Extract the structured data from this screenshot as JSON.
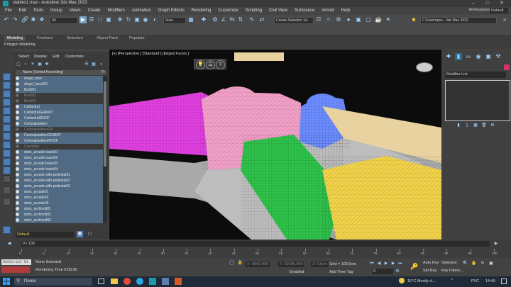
{
  "window": {
    "title": "stables1.max - Autodesk 3ds Max 2023",
    "minimize_icon": "minimize-icon",
    "maximize_icon": "maximize-icon",
    "close_icon": "close-icon"
  },
  "menu": {
    "items": [
      "File",
      "Edit",
      "Tools",
      "Group",
      "Views",
      "Create",
      "Modifiers",
      "Animation",
      "Graph Editors",
      "Rendering",
      "Customize",
      "Scripting",
      "Civil View",
      "Substance",
      "Arnold",
      "Help"
    ],
    "workspaces_label": "Workspaces:",
    "workspaces_value": "Default"
  },
  "toolbar": {
    "filter_value": "All",
    "view_value": "View",
    "selection_set_placeholder": "Create Selection Se",
    "path_value": "C:\\Users\\pce...3ds Max 2023"
  },
  "ribbon": {
    "tabs": [
      "Modeling",
      "Freeform",
      "Selection",
      "Object Paint",
      "Populate"
    ],
    "active_tab": "Modeling",
    "sub_label": "Polygon Modeling"
  },
  "explorer": {
    "tabs": [
      "Select",
      "Display",
      "Edit",
      "Customize"
    ],
    "column_header": "Name (Sorted Ascending)",
    "column_header_right": "Fr",
    "rows": [
      {
        "name": "Angel_face",
        "state": "sel"
      },
      {
        "name": "Angel_face001",
        "state": "sel"
      },
      {
        "name": "Box001",
        "state": "sel"
      },
      {
        "name": "Box002",
        "state": "dim"
      },
      {
        "name": "Box003",
        "state": "dim"
      },
      {
        "name": "Cathedral",
        "state": "sel"
      },
      {
        "name": "CathedralGRANIT",
        "state": "sel"
      },
      {
        "name": "CathedralROOF",
        "state": "sel"
      },
      {
        "name": "Centralpavilion",
        "state": "sel"
      },
      {
        "name": "Centralpavilion001",
        "state": "dim"
      },
      {
        "name": "CentralpavilionGRANIT",
        "state": "sel"
      },
      {
        "name": "CentralpavilionROOF",
        "state": "sel"
      },
      {
        "name": "Cupolaire",
        "state": "dim"
      },
      {
        "name": "doric_arcade basis01",
        "state": "sel"
      },
      {
        "name": "doric_arcade basis02",
        "state": "sel"
      },
      {
        "name": "doric_arcade basis03",
        "state": "sel"
      },
      {
        "name": "doric_arcade basis04",
        "state": "sel"
      },
      {
        "name": "doric_arcade with pedestal01",
        "state": "sel"
      },
      {
        "name": "doric_arcade with pedestal02",
        "state": "sel"
      },
      {
        "name": "doric_arcade with pedestal03",
        "state": "sel"
      },
      {
        "name": "doric_arcade01",
        "state": "sel"
      },
      {
        "name": "doric_arcade02",
        "state": "sel"
      },
      {
        "name": "doric_arcade03",
        "state": "sel"
      },
      {
        "name": "doric_archivolt01",
        "state": "sel"
      },
      {
        "name": "doric_archivolt02",
        "state": "sel"
      },
      {
        "name": "doric_archivolt03",
        "state": "sel"
      }
    ],
    "layer_value": "Default"
  },
  "viewport": {
    "label": "[+] [Perspective ] [Standard ] [Edged Faces ]",
    "colors": {
      "magenta": "#e040e0",
      "green": "#2ec24a",
      "pink": "#f2a0c8",
      "blue": "#6b8cff",
      "yellow": "#f2d24a",
      "cream": "#e8d2a0",
      "ground": "#a9a9a9"
    }
  },
  "command_panel": {
    "modifier_list": "Modifier List"
  },
  "timeline": {
    "frame_display": "0 / 100",
    "ticks": [
      "0",
      "5",
      "10",
      "15",
      "20",
      "25",
      "30",
      "35",
      "40",
      "45",
      "50",
      "55",
      "60",
      "65",
      "70",
      "75",
      "80",
      "85",
      "90",
      "95",
      "100"
    ]
  },
  "status": {
    "maxscript": "MAXScript Mi",
    "selection": "None Selected",
    "render_time": "Rendering Time  0:00:00",
    "x_value": "X: 6842,606",
    "y_value": "Y: 23096,399",
    "z_value": "Z: 0,0cm",
    "grid": "Grid = 100,0cm",
    "enabled_label": "Enabled:",
    "add_time_tag": "Add Time Tag",
    "auto_key": "Auto Key",
    "set_key": "Set Key",
    "selected": "Selected",
    "key_filters": "Key Filters...",
    "frame_value": "0"
  },
  "taskbar": {
    "search_label": "Поиск",
    "weather": "16°C  Mostly cl...",
    "lang": "РУС",
    "time": "14:49"
  }
}
